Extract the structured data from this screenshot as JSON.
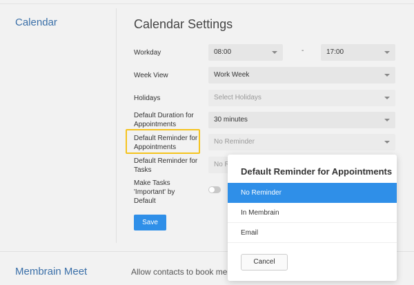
{
  "sidebar": {
    "title": "Calendar"
  },
  "settings": {
    "title": "Calendar Settings",
    "workday": {
      "label": "Workday",
      "start": "08:00",
      "separator": "-",
      "end": "17:00"
    },
    "week_view": {
      "label": "Week View",
      "value": "Work Week"
    },
    "holidays": {
      "label": "Holidays",
      "placeholder": "Select Holidays"
    },
    "duration": {
      "label_line1": "Default Duration for",
      "label_line2": "Appointments",
      "value": "30 minutes"
    },
    "reminder_appt": {
      "label_line1": "Default Reminder for",
      "label_line2": "Appointments",
      "value": "No Reminder"
    },
    "reminder_tasks": {
      "label_line1": "Default Reminder for",
      "label_line2": "Tasks",
      "value": "No R"
    },
    "important": {
      "label_line1": "Make Tasks",
      "label_line2": "'Important' by",
      "label_line3": "Default",
      "enabled": false
    },
    "save_label": "Save"
  },
  "meet": {
    "title": "Membrain Meet",
    "description": "Allow contacts to book me"
  },
  "popup": {
    "title": "Default Reminder for Appointments",
    "options": [
      "No Reminder",
      "In Membrain",
      "Email"
    ],
    "selected": "No Reminder",
    "cancel_label": "Cancel"
  },
  "colors": {
    "accent": "#2f8fe8",
    "highlight": "#f5c31d",
    "link": "#3a6fa8"
  }
}
